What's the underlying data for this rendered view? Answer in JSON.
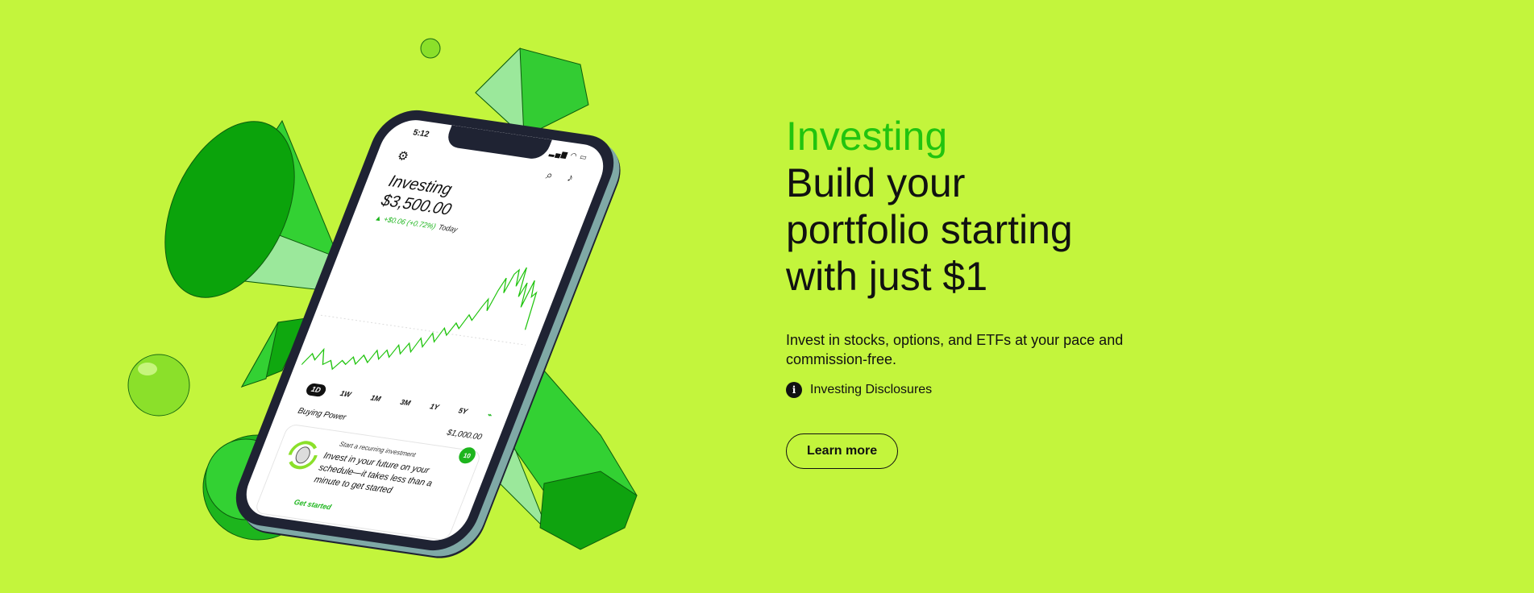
{
  "colors": {
    "background": "#c3f53c",
    "accent_green": "#21c40f",
    "text": "#111111"
  },
  "hero": {
    "eyebrow": "Investing",
    "headline_lines": [
      "Build your",
      "portfolio starting",
      "with just $1"
    ],
    "description": "Invest in stocks, options, and ETFs at your pace and commission-free.",
    "disclosures_icon": "info-icon",
    "disclosures_label": "Investing Disclosures",
    "cta_label": "Learn more"
  },
  "phone": {
    "status_time": "5:12",
    "icons": [
      "gear-icon",
      "search-icon",
      "bell-icon"
    ],
    "title": "Investing",
    "value": "$3,500.00",
    "change": "▲ +$0.06 (+0.72%)",
    "change_period": "Today",
    "ranges": [
      "1D",
      "1W",
      "1M",
      "3M",
      "1Y",
      "5Y"
    ],
    "active_range": "1D",
    "buying_power_label": "Buying Power",
    "buying_power_value": "$1,000.00",
    "card": {
      "kicker": "Start a recurring investment",
      "body": "Invest in your future on your schedule—it takes less than a minute to get started",
      "link": "Get started",
      "badge": "10"
    }
  }
}
